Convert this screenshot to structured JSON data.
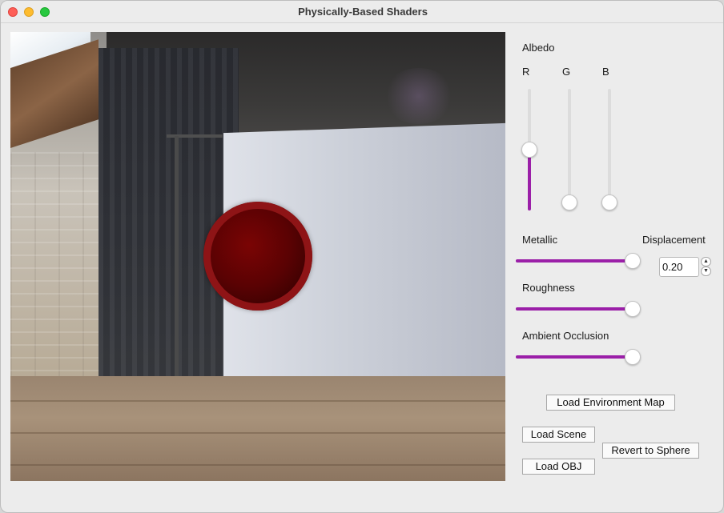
{
  "window": {
    "title": "Physically-Based Shaders"
  },
  "albedo": {
    "label": "Albedo",
    "channels": [
      {
        "label": "R",
        "value": 0.5
      },
      {
        "label": "G",
        "value": 0.0
      },
      {
        "label": "B",
        "value": 0.0
      }
    ]
  },
  "metallic": {
    "label": "Metallic",
    "value": 1.0
  },
  "displacement": {
    "label": "Displacement",
    "value": "0.20"
  },
  "roughness": {
    "label": "Roughness",
    "value": 1.0
  },
  "ambient_occlusion": {
    "label": "Ambient Occlusion",
    "value": 1.0
  },
  "buttons": {
    "load_env_map": "Load Environment Map",
    "load_scene": "Load Scene",
    "revert_sphere": "Revert to Sphere",
    "load_obj": "Load OBJ"
  },
  "colors": {
    "accent": "#9b1fa8",
    "sphere": "#5a0203"
  }
}
